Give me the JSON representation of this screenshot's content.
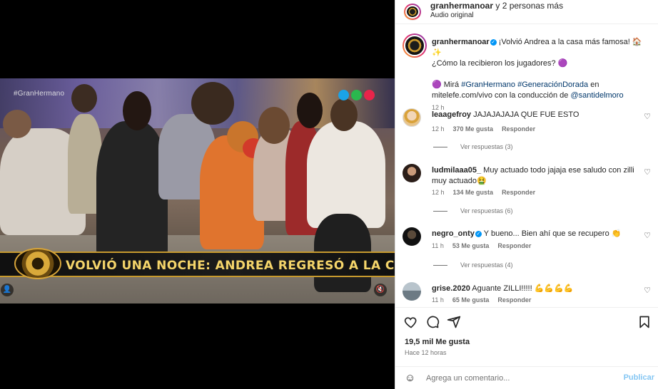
{
  "header": {
    "username": "granhermanoar",
    "others": " y 2 personas más",
    "audio": "Audio original"
  },
  "video": {
    "watermark": "#GranHermano",
    "banner": "VOLVIÓ UNA NOCHE: ANDREA REGRESÓ A LA CASA DE GH",
    "dot_colors": [
      "#1aa3e8",
      "#2ab84e",
      "#e8254a"
    ]
  },
  "caption": {
    "username": "granhermanoar",
    "line1": " ¡Volvió Andrea a la casa más famosa! 🏠 ✨",
    "line2": "¿Cómo la recibieron los jugadores? 🟣",
    "line3_prefix": "🟣  Mirá ",
    "hashtag1": "#GranHermano",
    "hashtag2": "#GeneraciónDorada",
    "line3_suffix": " en",
    "line4": "mitelefe.com/vivo con la conducción de ",
    "mention": "@santidelmoro",
    "time": "12 h"
  },
  "comments": [
    {
      "username": "leaagefroy",
      "text": "JAJAJAJAJA QUE FUE ESTO",
      "time": "12 h",
      "likes": "370 Me gusta",
      "reply": "Responder",
      "view_replies": "Ver respuestas (3)"
    },
    {
      "username": "ludmilaaa05_",
      "text": "Muy actuado todo jajaja ese saludo con zilli muy actuado🤮",
      "time": "12 h",
      "likes": "134 Me gusta",
      "reply": "Responder",
      "view_replies": "Ver respuestas (6)"
    },
    {
      "username": "negro_onty",
      "text": "Y bueno... Bien ahí que se recupero 👏",
      "time": "11 h",
      "likes": "53 Me gusta",
      "reply": "Responder",
      "view_replies": "Ver respuestas (4)"
    },
    {
      "username": "grise.2020",
      "text": "Aguante ZILLI!!!!! 💪💪💪💪",
      "time": "11 h",
      "likes": "65 Me gusta",
      "reply": "Responder"
    }
  ],
  "actions": {
    "likes": "19,5 mil Me gusta",
    "ago": "Hace 12 horas"
  },
  "add_comment": {
    "placeholder": "Agrega un comentario...",
    "publish": "Publicar"
  },
  "icons": {
    "heart": "heart-icon",
    "comment": "comment-icon",
    "share": "send-icon",
    "save": "bookmark-icon",
    "emoji": "emoji-icon",
    "mute": "mute-icon",
    "user": "user-tag-icon"
  }
}
